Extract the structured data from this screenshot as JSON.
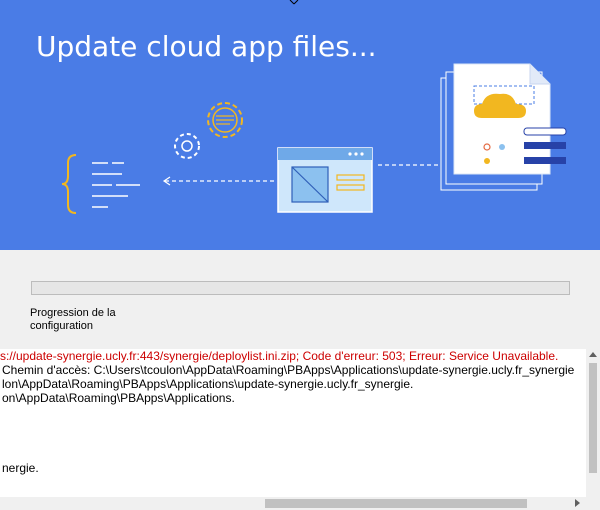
{
  "window": {
    "title": "Update cloud app files..."
  },
  "progress": {
    "label": "Progression de la configuration",
    "value_percent": 0
  },
  "log": {
    "lines": [
      {
        "text": "s://update-synergie.ucly.fr:443/synergie/deploylist.ini.zip; Code d'erreur: 503; Erreur: Service Unavailable.",
        "color": "#cc0000"
      },
      {
        "text": "Chemin d'accès: C:\\Users\\tcoulon\\AppData\\Roaming\\PBApps\\Applications\\update-synergie.ucly.fr_synergie",
        "color": "#000000"
      },
      {
        "text": "lon\\AppData\\Roaming\\PBApps\\Applications\\update-synergie.ucly.fr_synergie.",
        "color": "#000000"
      },
      {
        "text": "on\\AppData\\Roaming\\PBApps\\Applications.",
        "color": "#000000"
      },
      {
        "text": "",
        "color": "#000000"
      },
      {
        "text": "",
        "color": "#000000"
      },
      {
        "text": "",
        "color": "#000000"
      },
      {
        "text": "nergie.",
        "color": "#000000"
      }
    ]
  },
  "colors": {
    "banner": "#4a7ce6",
    "error_text": "#cc0000",
    "accent_yellow": "#f2b720",
    "accent_navy": "#2742a8"
  },
  "icons": [
    "gear-icon",
    "code-brace-icon",
    "cloud-icon",
    "document-icon",
    "window-icon",
    "close-icon"
  ]
}
